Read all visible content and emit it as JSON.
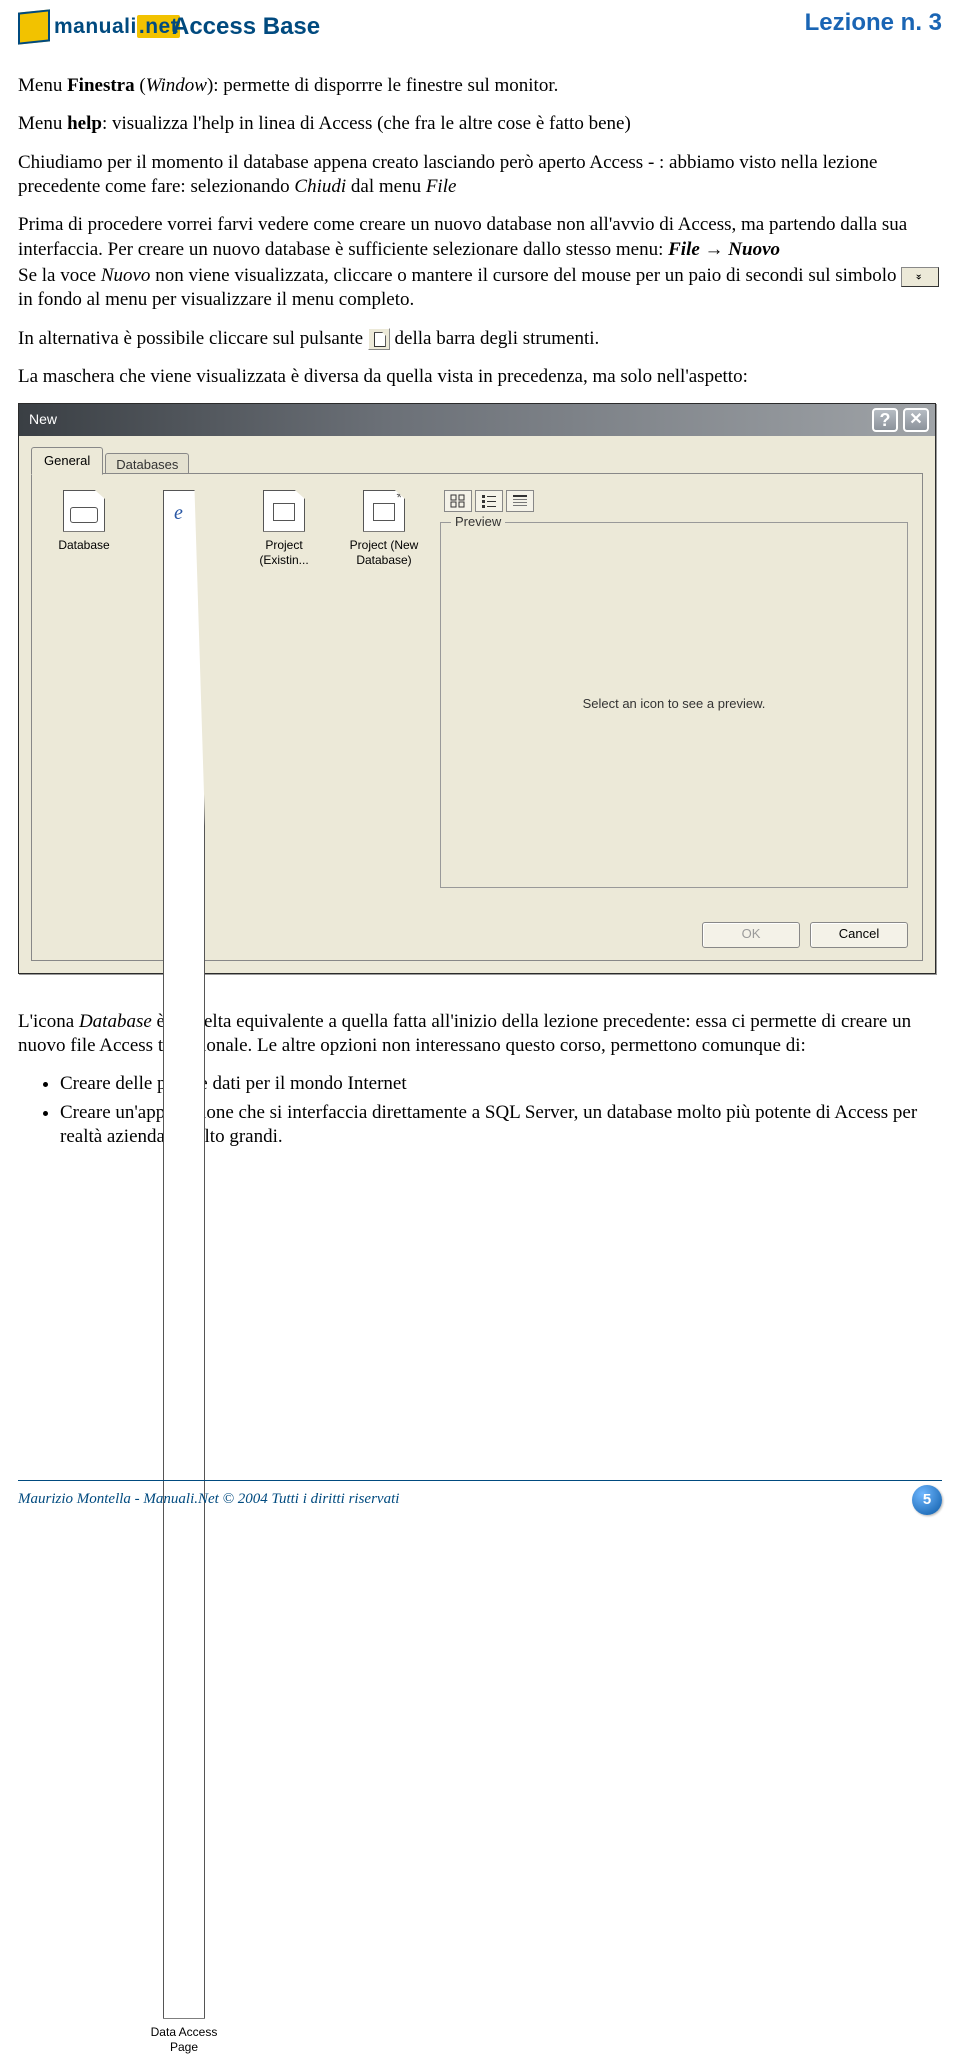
{
  "header": {
    "logo_brand": "manuali",
    "logo_domain": ".net",
    "title": "Access Base",
    "lesson": "Lezione n. 3"
  },
  "body": {
    "p1_a": "Menu ",
    "p1_b": "Finestra",
    "p1_c": " (",
    "p1_d": "Window",
    "p1_e": "): permette di disporrre le finestre sul monitor.",
    "p2_a": "Menu ",
    "p2_b": "help",
    "p2_c": ": visualizza l'help in linea di Access (che fra le altre cose è fatto bene)",
    "p3_a": "Chiudiamo per il momento il database appena creato lasciando però aperto Access - : abbiamo visto nella lezione precedente come fare: selezionando ",
    "p3_b": "Chiudi",
    "p3_c": " dal menu ",
    "p3_d": "File",
    "p4_a": "Prima di procedere vorrei farvi vedere come creare un nuovo database non all'avvio di Access, ma partendo dalla sua interfaccia. Per creare un nuovo database è sufficiente selezionare dallo stesso menu: ",
    "p4_b": "File",
    "p4_arrow": " → ",
    "p4_c": "Nuovo",
    "p5_a": "Se la voce ",
    "p5_b": "Nuovo",
    "p5_c": " non viene visualizzata, cliccare o mantere il cursore del mouse per un paio di secondi sul simbolo ",
    "p5_d": " in fondo al menu per visualizzare il menu completo.",
    "p6_a": "In alternativa è possibile cliccare sul pulsante ",
    "p6_b": " della barra degli strumenti.",
    "p7": "La maschera che viene visualizzata è diversa da quella vista in precedenza, ma solo nell'aspetto:",
    "p8_a": "L'icona ",
    "p8_b": "Database",
    "p8_c": " è la scelta equivalente a quella fatta all'inizio della lezione precedente: essa ci permette di creare un nuovo file Access tradizionale. Le altre opzioni non interessano questo corso, permettono comunque di:",
    "bullet1": "Creare delle pagine dati per il mondo Internet",
    "bullet2": "Creare un'applicazione che si interfaccia direttamente a SQL Server, un database molto più potente di Access per realtà aziendali molto grandi."
  },
  "dialog": {
    "title": "New",
    "tabs": {
      "general": "General",
      "databases": "Databases"
    },
    "icons": {
      "database": "Database",
      "data_access_page": "Data Access Page",
      "project_existing": "Project (Existin...",
      "project_new": "Project (New Database)"
    },
    "preview_legend": "Preview",
    "preview_placeholder": "Select an icon to see a preview.",
    "ok": "OK",
    "cancel": "Cancel"
  },
  "footer": {
    "text": "Maurizio Montella  - Manuali.Net © 2004  Tutti i diritti riservati",
    "page": "5"
  }
}
